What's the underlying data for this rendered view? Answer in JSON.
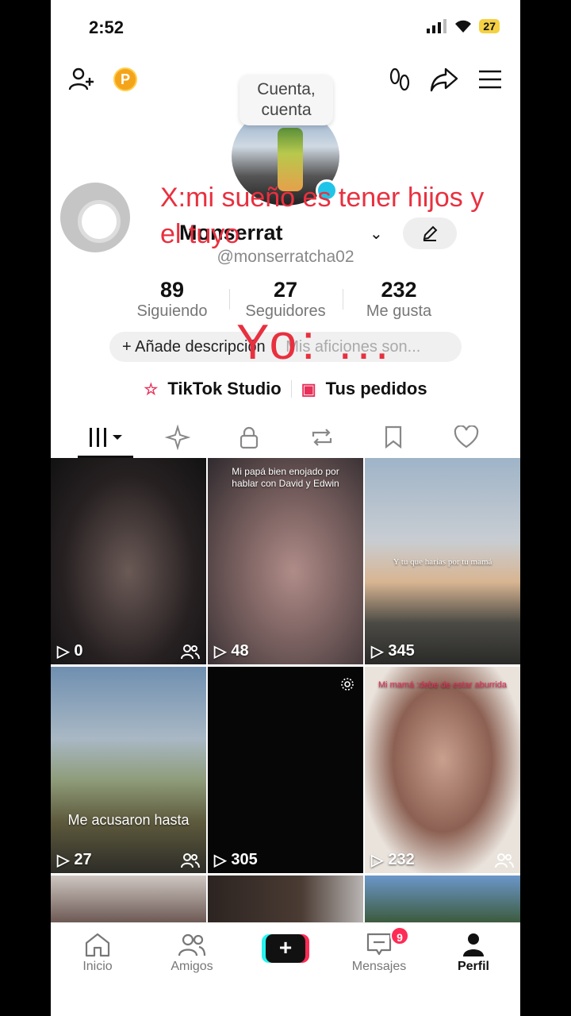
{
  "status": {
    "time": "2:52",
    "battery": "27"
  },
  "tooltip": {
    "text": "Cuenta, cuenta"
  },
  "overlay": {
    "top_text": "X:mi sueño es tener hijos y el tuyo",
    "bottom_text": "Yo: ..."
  },
  "profile": {
    "display_name": "Monserrat",
    "handle": "@monserratcha02",
    "stats": [
      {
        "value": "89",
        "label": "Siguiendo"
      },
      {
        "value": "27",
        "label": "Seguidores"
      },
      {
        "value": "232",
        "label": "Me gusta"
      }
    ],
    "bio_button": "+ Añade descripción",
    "bio_placeholder": "Mis aficiones son...",
    "links": {
      "studio": "TikTok Studio",
      "orders": "Tus pedidos"
    }
  },
  "tabs": [
    "videos-icon",
    "reposts-sparkle-icon",
    "lock-icon",
    "repost-icon",
    "bookmark-icon",
    "heart-icon"
  ],
  "grid": [
    {
      "count": "0",
      "friends": true,
      "caption": ""
    },
    {
      "count": "48",
      "friends": false,
      "caption": "Mi papá bien enojado por hablar con David y Edwin"
    },
    {
      "count": "345",
      "friends": false,
      "caption": "Y tu que harías por tu mamá"
    },
    {
      "count": "27",
      "friends": true,
      "caption": "Me acusaron hasta"
    },
    {
      "count": "305",
      "friends": false,
      "caption": ""
    },
    {
      "count": "232",
      "friends": true,
      "caption": "Mi mamá :debe de estar aburrida"
    }
  ],
  "nav": {
    "home": "Inicio",
    "friends": "Amigos",
    "messages": "Mensajes",
    "messages_badge": "9",
    "profile": "Perfil"
  },
  "colors": {
    "accent": "#fe2c55",
    "cyan": "#25f4ee",
    "overlay_red": "#e8303f"
  }
}
